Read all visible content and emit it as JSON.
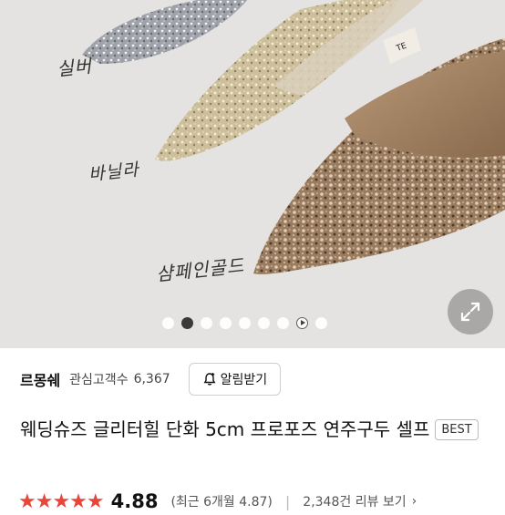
{
  "product_image": {
    "labels": {
      "silver": "실버",
      "vanilla": "바닐라",
      "champagne_gold": "샴페인골드"
    },
    "carousel": {
      "total": 9,
      "active_index": 1,
      "play_index": 7
    },
    "icons": {
      "expand": "expand-diagonal-icon",
      "play": "play-icon"
    }
  },
  "seller": {
    "name": "르몽쉐",
    "followers_label": "관심고객수",
    "followers_count": "6,367",
    "alarm_button": "알림받기",
    "alarm_icon": "bell-plus-icon"
  },
  "product": {
    "title": "웨딩슈즈 글리터힐 단화 5cm 프로포즈 연주구두 셀프",
    "badge": "BEST"
  },
  "rating": {
    "stars": 5,
    "score": "4.88",
    "recent_text": "(최근 6개월 4.87)",
    "reviews_text": "2,348건 리뷰 보기",
    "star_color": "#e8463b"
  }
}
